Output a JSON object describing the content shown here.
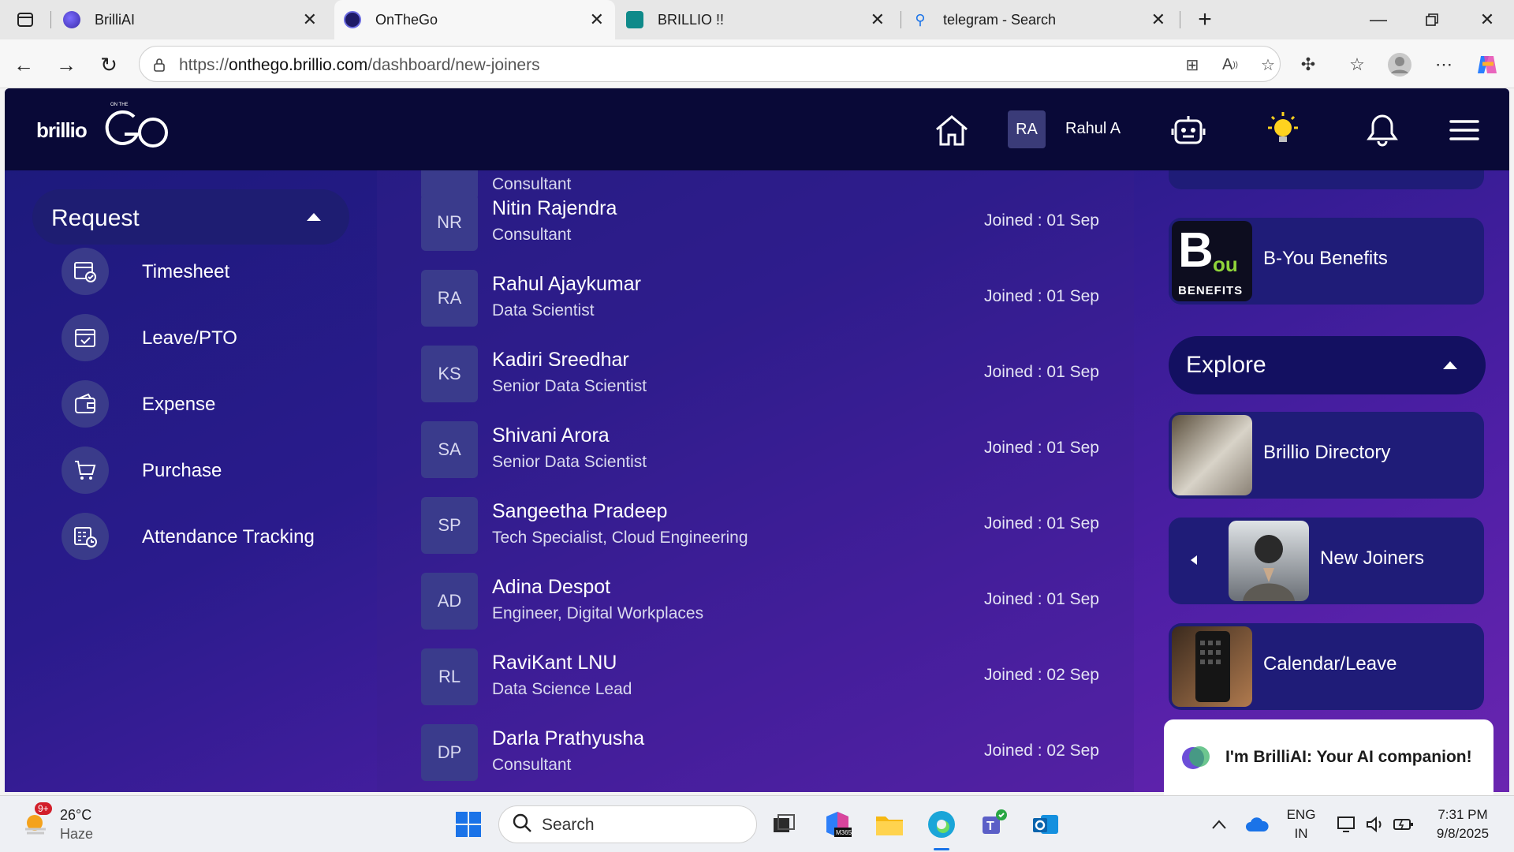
{
  "browser": {
    "tabs": [
      {
        "title": "BrilliAI",
        "active": false
      },
      {
        "title": "OnTheGo",
        "active": true
      },
      {
        "title": "BRILLIO !!",
        "active": false
      },
      {
        "title": "telegram - Search",
        "active": false
      }
    ],
    "url_prefix": "https://",
    "url_domain": "onthego.brillio.com",
    "url_path": "/dashboard/new-joiners"
  },
  "header": {
    "brand": "brillio",
    "logo_small": "ON THE",
    "logo_go": "GO",
    "user_initials": "RA",
    "user_name": "Rahul A"
  },
  "request": {
    "title": "Request",
    "items": [
      {
        "label": "Timesheet",
        "icon": "timesheet-icon"
      },
      {
        "label": "Leave/PTO",
        "icon": "leave-icon"
      },
      {
        "label": "Expense",
        "icon": "wallet-icon"
      },
      {
        "label": "Purchase",
        "icon": "cart-icon"
      },
      {
        "label": "Attendance Tracking",
        "icon": "attendance-icon"
      }
    ]
  },
  "joiners": {
    "partial_top_role": "Consultant",
    "rows": [
      {
        "initials": "NR",
        "name": "Nitin Rajendra",
        "role": "Consultant",
        "joined": "Joined : 01 Sep"
      },
      {
        "initials": "RA",
        "name": "Rahul Ajaykumar",
        "role": "Data Scientist",
        "joined": "Joined : 01 Sep"
      },
      {
        "initials": "KS",
        "name": "Kadiri Sreedhar",
        "role": "Senior Data Scientist",
        "joined": "Joined : 01 Sep"
      },
      {
        "initials": "SA",
        "name": "Shivani Arora",
        "role": "Senior Data Scientist",
        "joined": "Joined : 01 Sep"
      },
      {
        "initials": "SP",
        "name": "Sangeetha Pradeep",
        "role": "Tech Specialist, Cloud Engineering",
        "joined": "Joined : 01 Sep"
      },
      {
        "initials": "AD",
        "name": "Adina Despot",
        "role": "Engineer, Digital Workplaces",
        "joined": "Joined : 01 Sep"
      },
      {
        "initials": "RL",
        "name": "RaviKant LNU",
        "role": "Data Science Lead",
        "joined": "Joined : 02 Sep"
      },
      {
        "initials": "DP",
        "name": "Darla Prathyusha",
        "role": "Consultant",
        "joined": "Joined : 02 Sep"
      }
    ]
  },
  "right": {
    "benefits_label": "B-You Benefits",
    "benefits_logo_b": "B",
    "benefits_logo_you": "ou",
    "benefits_logo_word": "BENEFITS",
    "explore_title": "Explore",
    "explore_items": [
      {
        "label": "Brillio Directory"
      },
      {
        "label": "New Joiners"
      },
      {
        "label": "Calendar/Leave"
      }
    ],
    "ai_prompt": "I'm BrilliAI: Your AI companion!"
  },
  "taskbar": {
    "weather_temp": "26°C",
    "weather_desc": "Haze",
    "weather_badge": "9+",
    "search_placeholder": "Search",
    "lang_top": "ENG",
    "lang_bottom": "IN",
    "time": "7:31 PM",
    "date": "9/8/2025",
    "m365_label": "M365"
  },
  "colors": {
    "header_bg": "#090937",
    "accent_purple": "#4f1fa6",
    "tile_bg": "#3a3b8c"
  }
}
